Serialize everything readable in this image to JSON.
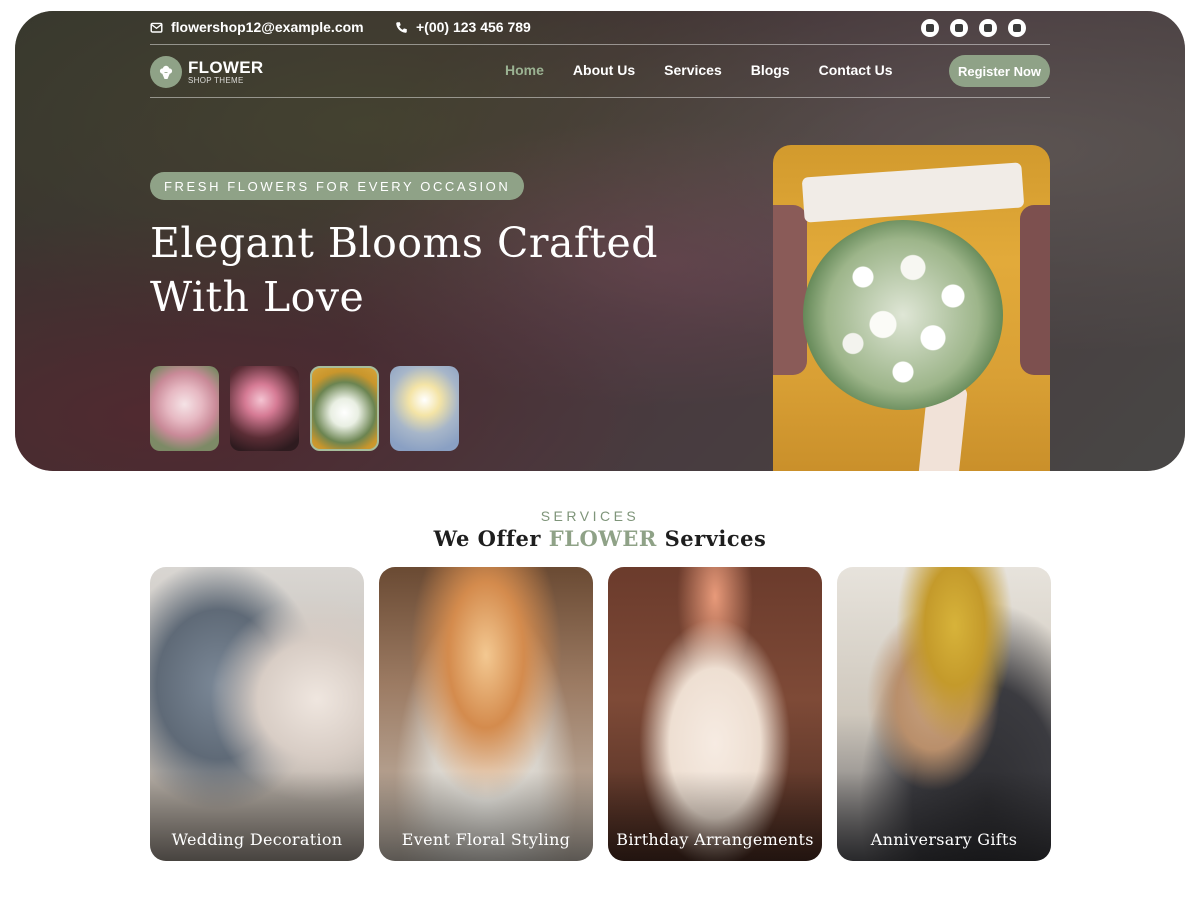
{
  "topbar": {
    "email": "flowershop12@example.com",
    "phone": "+(00) 123 456 789",
    "socials": [
      "facebook-icon",
      "twitter-icon",
      "youtube-icon",
      "instagram-icon"
    ]
  },
  "logo": {
    "line1": "FLOWER",
    "line2": "SHOP THEME"
  },
  "nav": {
    "items": [
      {
        "label": "Home",
        "active": true
      },
      {
        "label": "About Us"
      },
      {
        "label": "Services"
      },
      {
        "label": "Blogs"
      },
      {
        "label": "Contact Us"
      }
    ],
    "cta": "Register Now"
  },
  "hero": {
    "badge": "FRESH FLOWERS FOR EVERY OCCASION",
    "title_line1": "Elegant Blooms Crafted",
    "title_line2": "With Love",
    "thumbs_active_index": 2
  },
  "services": {
    "eyebrow": "SERVICES",
    "title_pre": "We Offer ",
    "title_accent": "FLOWER",
    "title_post": " Services",
    "cards": [
      {
        "label": "Wedding  Decoration"
      },
      {
        "label": "Event Floral Styling"
      },
      {
        "label": "Birthday Arrangements"
      },
      {
        "label": "Anniversary Gifts"
      }
    ]
  },
  "colors": {
    "accent": "#8fa287",
    "accent_text": "#9bb292"
  }
}
